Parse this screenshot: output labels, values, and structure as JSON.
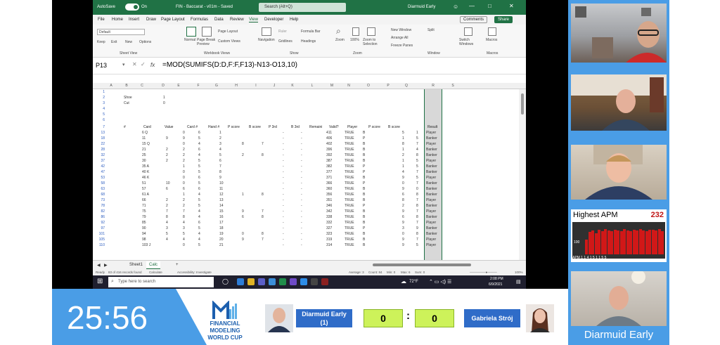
{
  "window": {
    "autosave_label": "AutoSave",
    "autosave_state": "On",
    "doc_title": "FIN - Baccarat - v01m - Saved",
    "search_placeholder": "Search (Alt+Q)",
    "user_name": "Diarmuid Early"
  },
  "menu": {
    "items": [
      "File",
      "Home",
      "Insert",
      "Draw",
      "Page Layout",
      "Formulas",
      "Data",
      "Review",
      "View",
      "Developer",
      "Help"
    ],
    "active": "View",
    "comments_label": "Comments",
    "share_label": "Share"
  },
  "ribbon": {
    "sheet_view_default": "Default",
    "sheet_view_buttons": [
      "Keep",
      "Exit",
      "New",
      "Options"
    ],
    "group_sheet_view": "Sheet View",
    "view_normal": "Normal",
    "view_page_break": "Page Break Preview",
    "view_page_layout": "Page Layout",
    "view_custom": "Custom Views",
    "group_workbook_views": "Workbook Views",
    "navigation": "Navigation",
    "show_ruler": "Ruler",
    "show_formula_bar": "Formula Bar",
    "show_gridlines": "Gridlines",
    "show_headings": "Headings",
    "group_show": "Show",
    "zoom": "Zoom",
    "zoom_100": "100%",
    "zoom_selection": "Zoom to Selection",
    "group_zoom": "Zoom",
    "new_window": "New Window",
    "arrange_all": "Arrange All",
    "freeze_panes": "Freeze Panes",
    "split": "Split",
    "switch_windows": "Switch Windows",
    "group_window": "Window",
    "macros": "Macros",
    "group_macros": "Macros"
  },
  "formula_bar": {
    "cell_ref": "P13",
    "fx": "fx",
    "formula": "=MOD(SUMIFS(D:D,F:F,F13)-N13-O13,10)"
  },
  "grid": {
    "columns": [
      "A",
      "B",
      "C",
      "D",
      "E",
      "F",
      "G",
      "H",
      "I",
      "J",
      "K",
      "L",
      "M",
      "N",
      "O",
      "P",
      "Q",
      "R",
      "S"
    ],
    "top_rows": [
      {
        "rn": "1",
        "label": "",
        "value": ""
      },
      {
        "rn": "2",
        "label": "Shoe",
        "value": "1"
      },
      {
        "rn": "3",
        "label": "Cut",
        "value": "0"
      },
      {
        "rn": "4",
        "label": "",
        "value": ""
      },
      {
        "rn": "5",
        "label": "",
        "value": ""
      },
      {
        "rn": "6",
        "label": "",
        "value": ""
      }
    ],
    "header_row_num": "7",
    "headers": [
      "#",
      "Card",
      "Value",
      "Card #",
      "Hand #",
      "P score",
      "B score",
      "P 3rd",
      "B 3rd",
      "Remaini",
      "Valid?",
      "Player",
      "P score",
      "B score",
      "Result"
    ],
    "rows": [
      {
        "rn": "13",
        "c": [
          "",
          "6 Q",
          "",
          "0",
          "6",
          "1",
          "",
          "",
          "-",
          "-",
          "411",
          "TRUE",
          "B",
          "",
          "5",
          "1",
          "Player"
        ]
      },
      {
        "rn": "18",
        "c": [
          "",
          "11",
          "9",
          "9",
          "5",
          "2",
          "",
          "",
          "-",
          "-",
          "406",
          "TRUE",
          "P",
          "",
          "1",
          "5",
          "Banker"
        ]
      },
      {
        "rn": "22",
        "c": [
          "",
          "15 Q",
          "",
          "0",
          "4",
          "3",
          "8",
          "7",
          "-",
          "-",
          "402",
          "TRUE",
          "B",
          "",
          "8",
          "7",
          "Player"
        ]
      },
      {
        "rn": "28",
        "c": [
          "",
          "21",
          "2",
          "2",
          "6",
          "4",
          "",
          "",
          "-",
          "-",
          "396",
          "TRUE",
          "B",
          "",
          "1",
          "4",
          "Banker"
        ]
      },
      {
        "rn": "32",
        "c": [
          "",
          "25",
          "2",
          "2",
          "4",
          "5",
          "2",
          "8",
          "-",
          "-",
          "392",
          "TRUE",
          "B",
          "",
          "2",
          "8",
          "Banker"
        ]
      },
      {
        "rn": "37",
        "c": [
          "",
          "30",
          "2",
          "2",
          "5",
          "6",
          "",
          "",
          "-",
          "-",
          "387",
          "TRUE",
          "B",
          "",
          "1",
          "5",
          "Player"
        ]
      },
      {
        "rn": "42",
        "c": [
          "",
          "35 A",
          "",
          "1",
          "5",
          "7",
          "",
          "",
          "-",
          "-",
          "382",
          "TRUE",
          "P",
          "",
          "1",
          "5",
          "Banker"
        ]
      },
      {
        "rn": "47",
        "c": [
          "",
          "40 K",
          "",
          "0",
          "5",
          "8",
          "",
          "",
          "-",
          "-",
          "377",
          "TRUE",
          "P",
          "",
          "4",
          "7",
          "Banker"
        ]
      },
      {
        "rn": "53",
        "c": [
          "",
          "46 K",
          "",
          "0",
          "6",
          "9",
          "",
          "",
          "-",
          "-",
          "371",
          "TRUE",
          "B",
          "",
          "9",
          "5",
          "Player"
        ]
      },
      {
        "rn": "58",
        "c": [
          "",
          "51",
          "10",
          "0",
          "5",
          "10",
          "",
          "",
          "-",
          "-",
          "366",
          "TRUE",
          "P",
          "",
          "0",
          "7",
          "Banker"
        ]
      },
      {
        "rn": "63",
        "c": [
          "",
          "57",
          "6",
          "6",
          "6",
          "11",
          "",
          "",
          "-",
          "-",
          "360",
          "TRUE",
          "B",
          "",
          "9",
          "0",
          "Banker"
        ]
      },
      {
        "rn": "68",
        "c": [
          "",
          "61 A",
          "",
          "1",
          "4",
          "12",
          "1",
          "8",
          "-",
          "-",
          "356",
          "TRUE",
          "B",
          "",
          "6",
          "8",
          "Banker"
        ]
      },
      {
        "rn": "73",
        "c": [
          "",
          "66",
          "2",
          "2",
          "5",
          "13",
          "",
          "",
          "-",
          "-",
          "351",
          "TRUE",
          "B",
          "",
          "8",
          "7",
          "Player"
        ]
      },
      {
        "rn": "78",
        "c": [
          "",
          "71",
          "2",
          "2",
          "5",
          "14",
          "",
          "",
          "-",
          "-",
          "346",
          "TRUE",
          "P",
          "",
          "2",
          "8",
          "Banker"
        ]
      },
      {
        "rn": "82",
        "c": [
          "",
          "75",
          "7",
          "7",
          "4",
          "15",
          "9",
          "7",
          "-",
          "-",
          "342",
          "TRUE",
          "B",
          "",
          "9",
          "7",
          "Player"
        ]
      },
      {
        "rn": "86",
        "c": [
          "",
          "79",
          "8",
          "8",
          "4",
          "16",
          "6",
          "8",
          "-",
          "-",
          "338",
          "TRUE",
          "B",
          "",
          "6",
          "8",
          "Banker"
        ]
      },
      {
        "rn": "92",
        "c": [
          "",
          "85",
          "4",
          "4",
          "6",
          "17",
          "",
          "",
          "-",
          "-",
          "332",
          "TRUE",
          "B",
          "",
          "9",
          "7",
          "Player"
        ]
      },
      {
        "rn": "97",
        "c": [
          "",
          "90",
          "3",
          "3",
          "5",
          "18",
          "",
          "",
          "-",
          "-",
          "327",
          "TRUE",
          "P",
          "",
          "3",
          "9",
          "Banker"
        ]
      },
      {
        "rn": "101",
        "c": [
          "",
          "94",
          "5",
          "5",
          "4",
          "19",
          "0",
          "8",
          "-",
          "-",
          "323",
          "TRUE",
          "B",
          "",
          "0",
          "8",
          "Banker"
        ]
      },
      {
        "rn": "105",
        "c": [
          "",
          "98",
          "4",
          "4",
          "4",
          "20",
          "9",
          "7",
          "-",
          "-",
          "319",
          "TRUE",
          "B",
          "",
          "9",
          "7",
          "Player"
        ]
      },
      {
        "rn": "110",
        "c": [
          "",
          "103 J",
          "",
          "0",
          "5",
          "21",
          "",
          "",
          "-",
          "-",
          "314",
          "TRUE",
          "B",
          "",
          "9",
          "5",
          "Player"
        ]
      }
    ]
  },
  "sheets": {
    "tabs": [
      "Sheet1",
      "Calc"
    ],
    "active": "Calc",
    "add": "+"
  },
  "statusbar": {
    "ready": "Ready",
    "records": "83 of 416 records found",
    "calculate": "Calculate",
    "accessibility": "Accessibility: Investigate",
    "average": "Average: 3",
    "count": "Count: 84",
    "min": "Min: 0",
    "max": "Max: 6",
    "sum": "Sum: 0",
    "zoom": "100%"
  },
  "taskbar": {
    "search_placeholder": "Type here to search",
    "weather": "72°F",
    "time": "2:08 PM",
    "date": "6/9/2021"
  },
  "stream": {
    "apm_label": "Highest APM",
    "apm_value": "232",
    "apm_base": "100",
    "apm_bars": [
      0.55,
      0.85,
      0.9,
      0.8,
      0.92,
      0.88,
      0.95,
      0.9,
      0.87,
      0.93,
      0.9,
      0.86,
      0.94,
      0.9,
      0.88,
      0.92,
      0.89,
      0.95,
      0.9,
      0.87,
      0.93,
      0.91,
      0.9,
      0.94,
      0.88
    ],
    "apm_footer": "APM  1 1 4        1 5 1        1 5 5",
    "timer": "25:56",
    "logo_line1": "FINANCIAL MODELING",
    "logo_line2": "WORLD CUP",
    "player1_name": "Diarmuid Early",
    "player1_seed": "(1)",
    "score1": "0",
    "score_sep": ":",
    "score2": "0",
    "player2_name": "Gabriela Strój",
    "caption": "Diarmuid Early"
  }
}
